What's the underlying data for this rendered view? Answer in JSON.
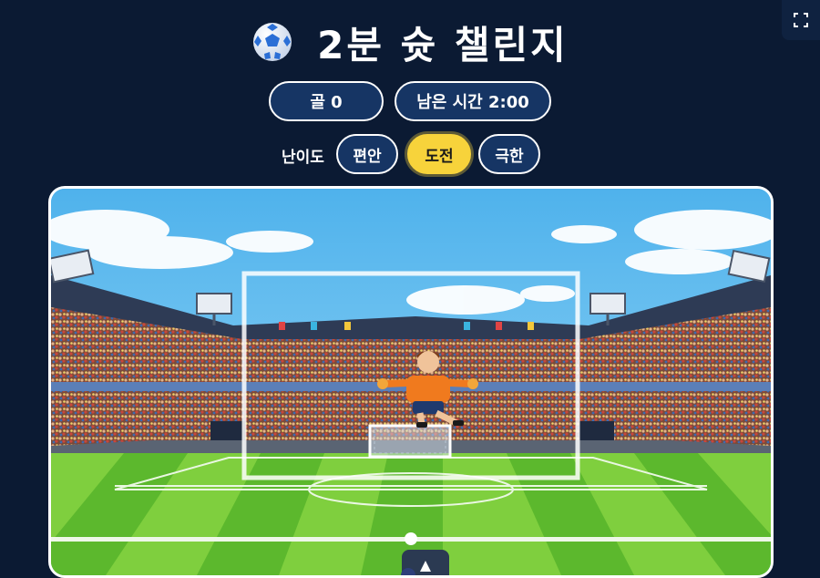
{
  "title": "2분 슛 챌린지",
  "stats": {
    "goals_label": "골 0",
    "time_label": "남은 시간 2:00"
  },
  "difficulty": {
    "label": "난이도",
    "options": [
      "편안",
      "도전",
      "극한"
    ],
    "selected": "도전"
  },
  "icons": {
    "title_icon": "soccer-ball-icon",
    "fullscreen_icon": "fullscreen-icon",
    "aim_icon": "aim-arrow-icon"
  },
  "colors": {
    "background": "#0b1a33",
    "pill": "#163564",
    "active": "#f7d33b",
    "grass_light": "#7fcf3e",
    "grass_dark": "#5cb82d",
    "keeper_jersey": "#f07a1e"
  }
}
